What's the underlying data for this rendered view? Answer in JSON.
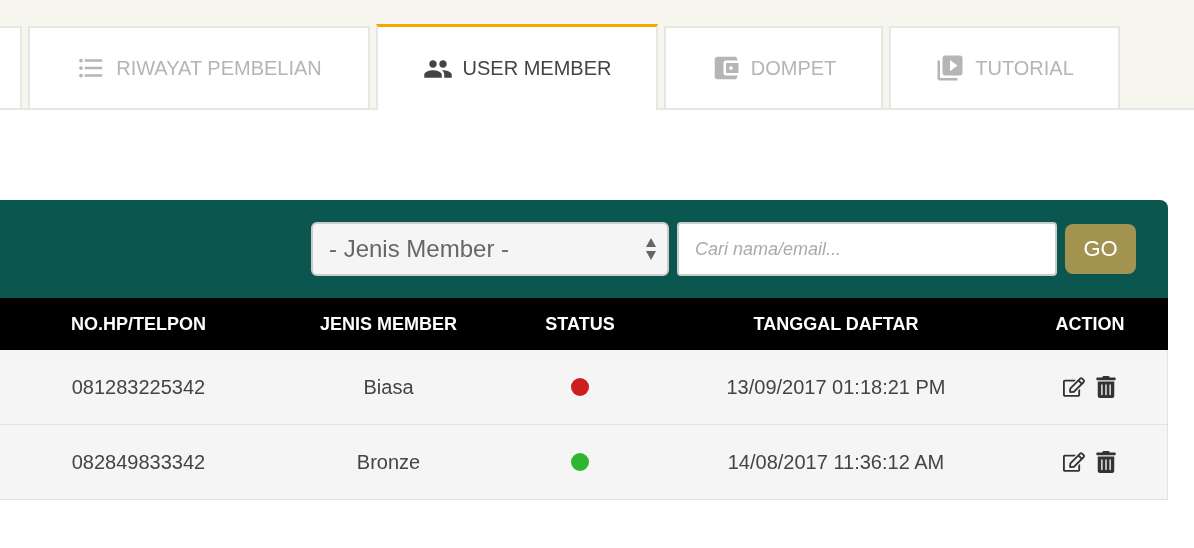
{
  "tabs": [
    {
      "label": "RIWAYAT PEMBELIAN",
      "selected": false
    },
    {
      "label": "USER MEMBER",
      "selected": true
    },
    {
      "label": "DOMPET",
      "selected": false
    },
    {
      "label": "TUTORIAL",
      "selected": false
    }
  ],
  "filter": {
    "member_type": "- Jenis Member -",
    "search_placeholder": "Cari nama/email...",
    "go": "GO"
  },
  "table": {
    "columns": [
      "NO.HP/TELPON",
      "JENIS MEMBER",
      "STATUS",
      "TANGGAL DAFTAR",
      "ACTION"
    ],
    "rows": [
      {
        "phone": "081283225342",
        "member_type": "Biasa",
        "color": "#cc1f1f",
        "registered": "13/09/2017 01:18:21 PM"
      },
      {
        "phone": "082849833342",
        "member_type": "Bronze",
        "color": "#2fb52f",
        "registered": "14/08/2017 11:36:12 AM"
      }
    ]
  }
}
